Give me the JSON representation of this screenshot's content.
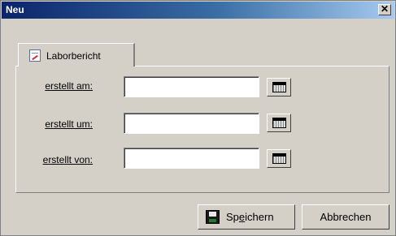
{
  "window": {
    "title": "Neu",
    "close_label": "✕"
  },
  "tab": {
    "label": "Laborbericht",
    "icon": "report-icon"
  },
  "form": {
    "fields": [
      {
        "label": "erstellt am:",
        "value": "",
        "button_icon": "calendar-icon"
      },
      {
        "label": "erstellt um:",
        "value": "",
        "button_icon": "calendar-icon"
      },
      {
        "label": "erstellt von:",
        "value": "",
        "button_icon": "calendar-icon"
      }
    ]
  },
  "buttons": {
    "save_pre": "Sp",
    "save_access": "e",
    "save_post": "ichern",
    "save_icon": "floppy-disk-icon",
    "cancel_label": "Abbrechen"
  }
}
